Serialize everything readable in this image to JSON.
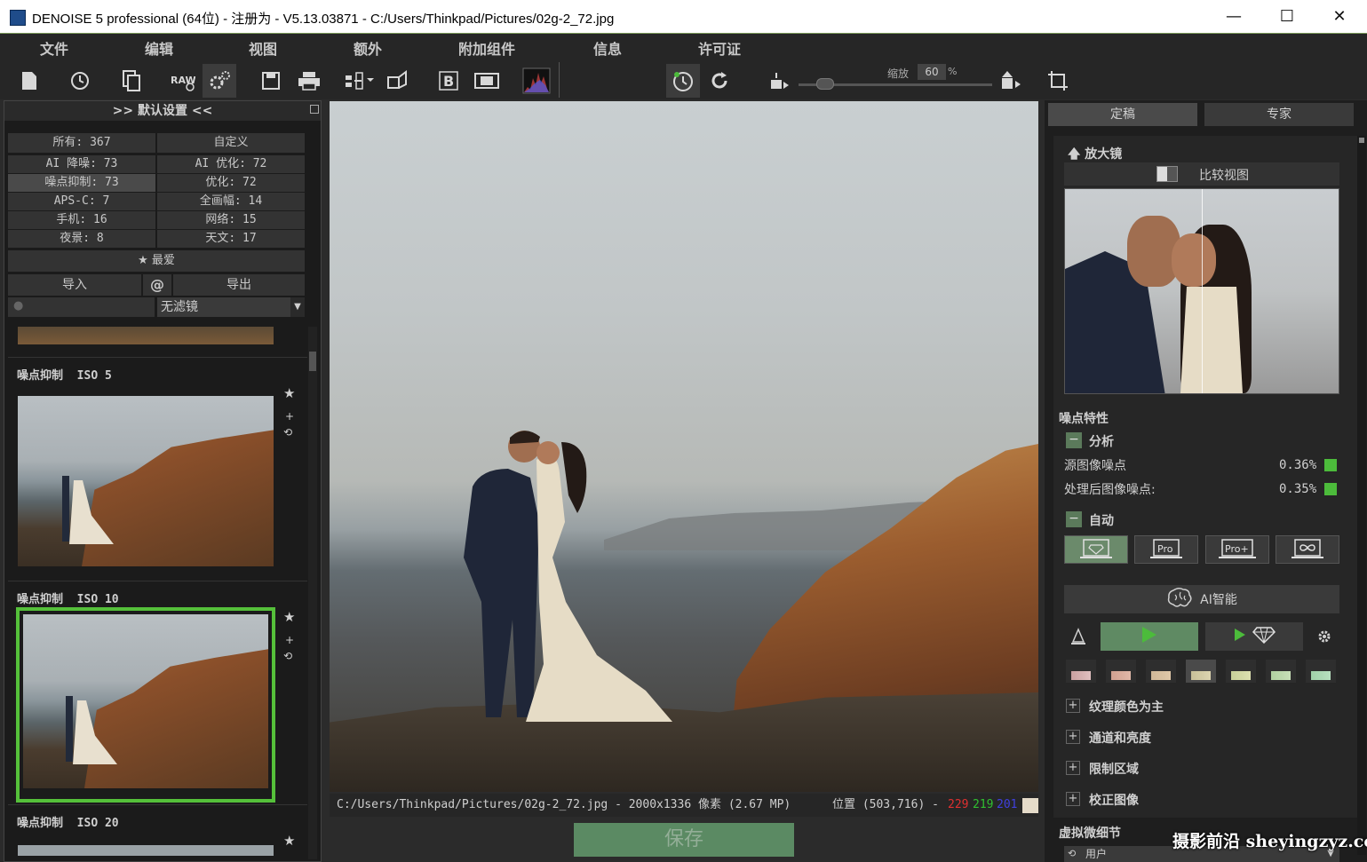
{
  "window": {
    "title": "DENOISE 5 professional (64位) - 注册为 - V5.13.03871 - C:/Users/Thinkpad/Pictures/02g-2_72.jpg",
    "min": "—",
    "max": "☐",
    "close": "✕"
  },
  "menu": [
    "文件",
    "编辑",
    "视图",
    "额外",
    "附加组件",
    "信息",
    "许可证"
  ],
  "toolbar": {
    "zoom_label": "缩放",
    "zoom_value": "60",
    "zoom_unit": "%",
    "zoom_fraction": 0.1,
    "icons": [
      "new-file-icon",
      "history-icon",
      "batch-icon",
      "raw-icon",
      "settings-icon",
      "save-icon",
      "print-icon",
      "export-icon",
      "compare-icon",
      "b-icon",
      "filmstrip-icon",
      "histogram-icon"
    ]
  },
  "left": {
    "header": ">> 默认设置 <<",
    "filters": [
      [
        "所有: 367",
        "自定义"
      ],
      [
        "AI 降噪: 73",
        "AI 优化: 72"
      ],
      [
        "噪点抑制: 73",
        "优化: 72"
      ],
      [
        "APS-C: 7",
        "全画幅: 14"
      ],
      [
        "手机: 16",
        "网络: 15"
      ],
      [
        "夜景: 8",
        "天文: 17"
      ]
    ],
    "favorites": "最爱",
    "import": "导入",
    "at": "@",
    "export": "导出",
    "search_placeholder": "",
    "filter_select": "无滤镜",
    "presets": [
      {
        "name": "噪点抑制",
        "iso": "ISO 5"
      },
      {
        "name": "噪点抑制",
        "iso": "ISO 10"
      },
      {
        "name": "噪点抑制",
        "iso": "ISO 20"
      }
    ]
  },
  "status": {
    "path": "C:/Users/Thinkpad/Pictures/02g-2_72.jpg - 2000x1336 像素 (2.67 MP)",
    "position": "位置 (503,716) -",
    "r": "229",
    "g": "219",
    "b": "201",
    "r_color": "#e03030",
    "g_color": "#30c030",
    "b_color": "#4040e0"
  },
  "save": "保存",
  "right": {
    "tabs": [
      "定稿",
      "专家"
    ],
    "magnifier": "放大镜",
    "compare": "比较视图",
    "noise_props": "噪点特性",
    "analysis": "分析",
    "src_noise_label": "源图像噪点",
    "src_noise_value": "0.36%",
    "out_noise_label": "处理后图像噪点:",
    "out_noise_value": "0.35%",
    "auto": "自动",
    "modes": [
      "",
      "Pro",
      "Pro+",
      ""
    ],
    "ai_label": "AI智能",
    "sections": [
      "纹理颜色为主",
      "通道和亮度",
      "限制区域",
      "校正图像"
    ],
    "virtual": "虚拟微细节",
    "user": "用户",
    "accent": "#4cbb3b"
  },
  "watermark": "摄影前沿 sheyingzyz.com"
}
